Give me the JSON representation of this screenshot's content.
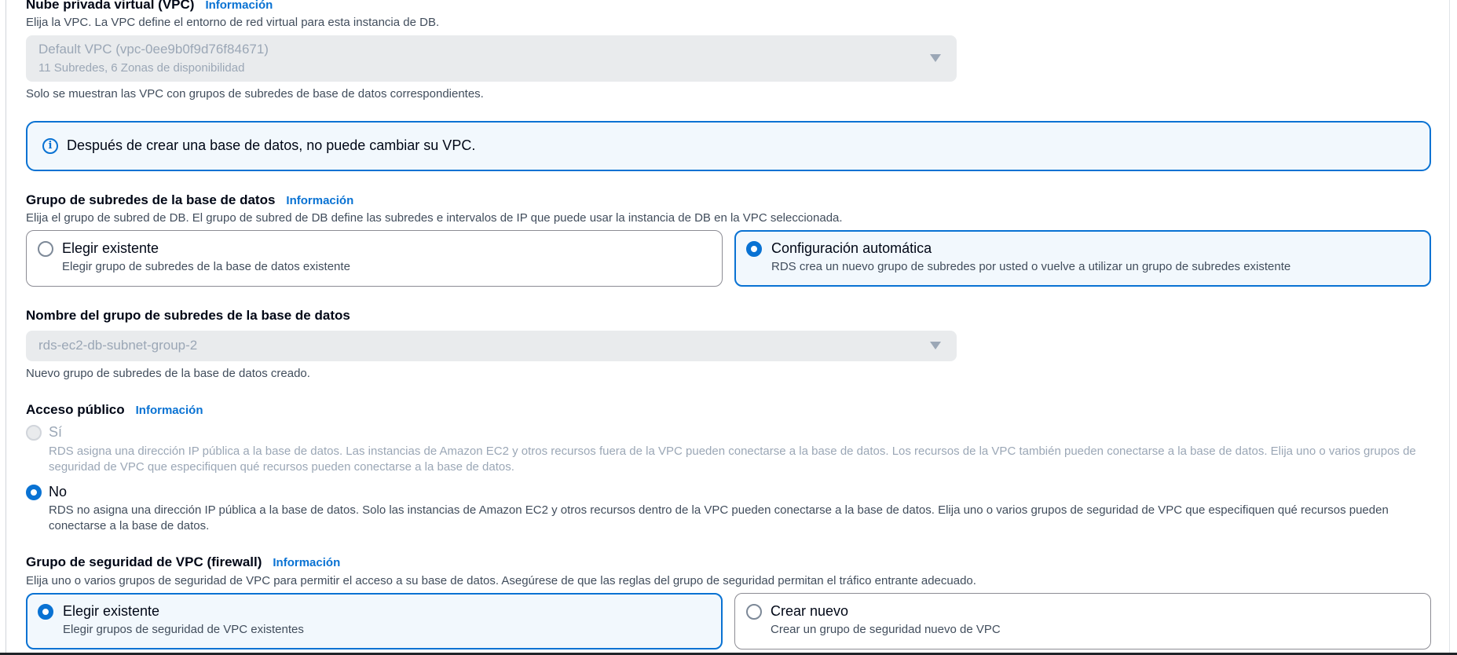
{
  "vpc": {
    "label": "Nube privada virtual (VPC)",
    "info": "Información",
    "description": "Elija la VPC. La VPC define el entorno de red virtual para esta instancia de DB.",
    "select_value": "Default VPC (vpc-0ee9b0f9d76f84671)",
    "select_sub": "11 Subredes, 6 Zonas de disponibilidad",
    "hint": "Solo se muestran las VPC con grupos de subredes de base de datos correspondientes.",
    "alert": "Después de crear una base de datos, no puede cambiar su VPC."
  },
  "subnet_group": {
    "label": "Grupo de subredes de la base de datos",
    "info": "Información",
    "description": "Elija el grupo de subred de DB. El grupo de subred de DB define las subredes e intervalos de IP que puede usar la instancia de DB en la VPC seleccionada.",
    "options": [
      {
        "title": "Elegir existente",
        "desc": "Elegir grupo de subredes de la base de datos existente",
        "selected": false
      },
      {
        "title": "Configuración automática",
        "desc": "RDS crea un nuevo grupo de subredes por usted o vuelve a utilizar un grupo de subredes existente",
        "selected": true
      }
    ]
  },
  "subnet_name": {
    "label": "Nombre del grupo de subredes de la base de datos",
    "select_value": "rds-ec2-db-subnet-group-2",
    "hint": "Nuevo grupo de subredes de la base de datos creado."
  },
  "public_access": {
    "label": "Acceso público",
    "info": "Información",
    "options": [
      {
        "title": "Sí",
        "desc": "RDS asigna una dirección IP pública a la base de datos. Las instancias de Amazon EC2 y otros recursos fuera de la VPC pueden conectarse a la base de datos. Los recursos de la VPC también pueden conectarse a la base de datos. Elija uno o varios grupos de seguridad de VPC que especifiquen qué recursos pueden conectarse a la base de datos.",
        "selected": false,
        "disabled": true
      },
      {
        "title": "No",
        "desc": "RDS no asigna una dirección IP pública a la base de datos. Solo las instancias de Amazon EC2 y otros recursos dentro de la VPC pueden conectarse a la base de datos. Elija uno o varios grupos de seguridad de VPC que especifiquen qué recursos pueden conectarse a la base de datos.",
        "selected": true,
        "disabled": false
      }
    ]
  },
  "security_group": {
    "label": "Grupo de seguridad de VPC (firewall)",
    "info": "Información",
    "description": "Elija uno o varios grupos de seguridad de VPC para permitir el acceso a su base de datos. Asegúrese de que las reglas del grupo de seguridad permitan el tráfico entrante adecuado.",
    "options": [
      {
        "title": "Elegir existente",
        "desc": "Elegir grupos de seguridad de VPC existentes",
        "selected": true
      },
      {
        "title": "Crear nuevo",
        "desc": "Crear un grupo de seguridad nuevo de VPC",
        "selected": false
      }
    ]
  },
  "colors": {
    "accent": "#0972d3",
    "selected_bg": "#f2f8fd",
    "disabled_text": "#9ba7b6",
    "field_bg": "#e9ebed"
  }
}
